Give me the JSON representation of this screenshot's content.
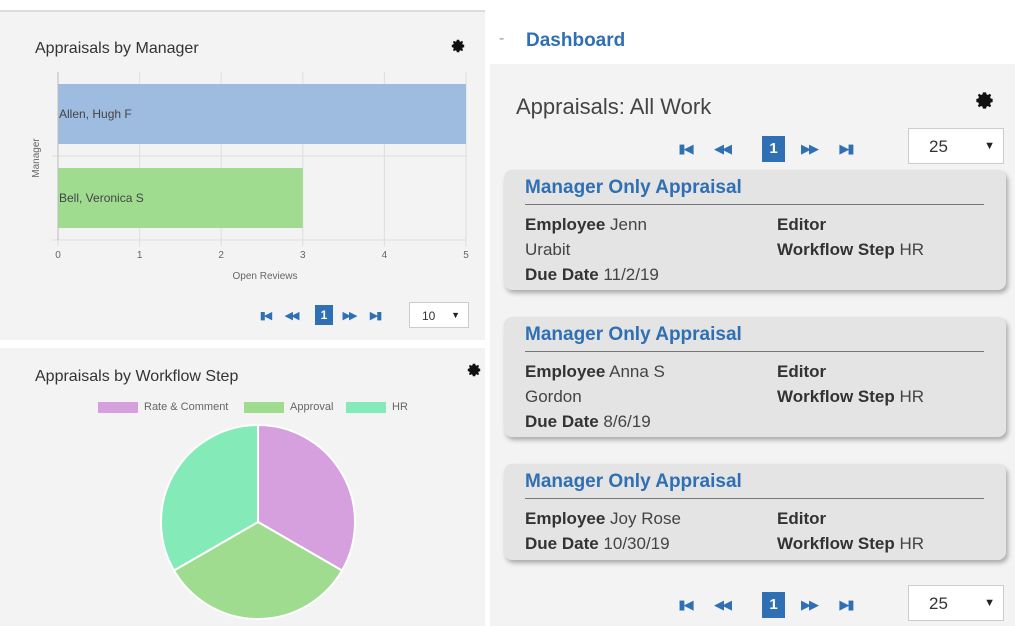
{
  "bar_panel": {
    "title": "Appraisals by Manager",
    "ylabel": "Manager",
    "xlabel": "Open Reviews",
    "pager": {
      "first": "⏮",
      "prev": "«",
      "page": "1",
      "next": "»",
      "last": "⏭",
      "page_size": "10"
    }
  },
  "pie_panel": {
    "title": "Appraisals by Workflow Step",
    "legend": [
      "Rate & Comment",
      "Approval",
      "HR"
    ]
  },
  "dashboard": {
    "collapse_glyph": "-",
    "title": "Dashboard",
    "panel_title": "Appraisals: All Work",
    "pager_top": {
      "page": "1",
      "page_size": "25"
    },
    "pager_bottom": {
      "page": "1",
      "page_size": "25"
    },
    "cards": [
      {
        "title": "Manager Only Appraisal",
        "employee_label": "Employee",
        "employee_value": "Jenn",
        "employee_value_2": "Urabit",
        "editor_label": "Editor",
        "workflow_label": "Workflow Step",
        "workflow_value": "HR",
        "due_label": "Due Date",
        "due_value": "11/2/19"
      },
      {
        "title": "Manager Only Appraisal",
        "employee_label": "Employee",
        "employee_value": "Anna S",
        "employee_value_2": "Gordon",
        "editor_label": "Editor",
        "workflow_label": "Workflow Step",
        "workflow_value": "HR",
        "due_label": "Due Date",
        "due_value": "8/6/19"
      },
      {
        "title": "Manager Only Appraisal",
        "employee_label": "Employee",
        "employee_value": "Joy Rose",
        "editor_label": "Editor",
        "workflow_label": "Workflow Step",
        "workflow_value": "HR",
        "due_label": "Due Date",
        "due_value": "10/30/19"
      }
    ]
  },
  "colors": {
    "accent": "#2f6fb3",
    "bar_allen": "#9dbce0",
    "bar_bell": "#9fdc8f",
    "pie_rate": "#d69fdd",
    "pie_approval": "#9fdc8f",
    "pie_hr": "#84ebb8"
  },
  "chart_data": [
    {
      "type": "bar",
      "orientation": "horizontal",
      "title": "Appraisals by Manager",
      "categories": [
        "Allen, Hugh F",
        "Bell, Veronica S"
      ],
      "values": [
        5,
        3
      ],
      "xlabel": "Open Reviews",
      "ylabel": "Manager",
      "xlim": [
        0,
        5
      ],
      "xticks": [
        "0",
        "1",
        "2",
        "3",
        "4",
        "5"
      ],
      "grid": true
    },
    {
      "type": "pie",
      "title": "Appraisals by Workflow Step",
      "categories": [
        "Rate & Comment",
        "Approval",
        "HR"
      ],
      "values": [
        1,
        1,
        1
      ],
      "legend_position": "top"
    }
  ]
}
